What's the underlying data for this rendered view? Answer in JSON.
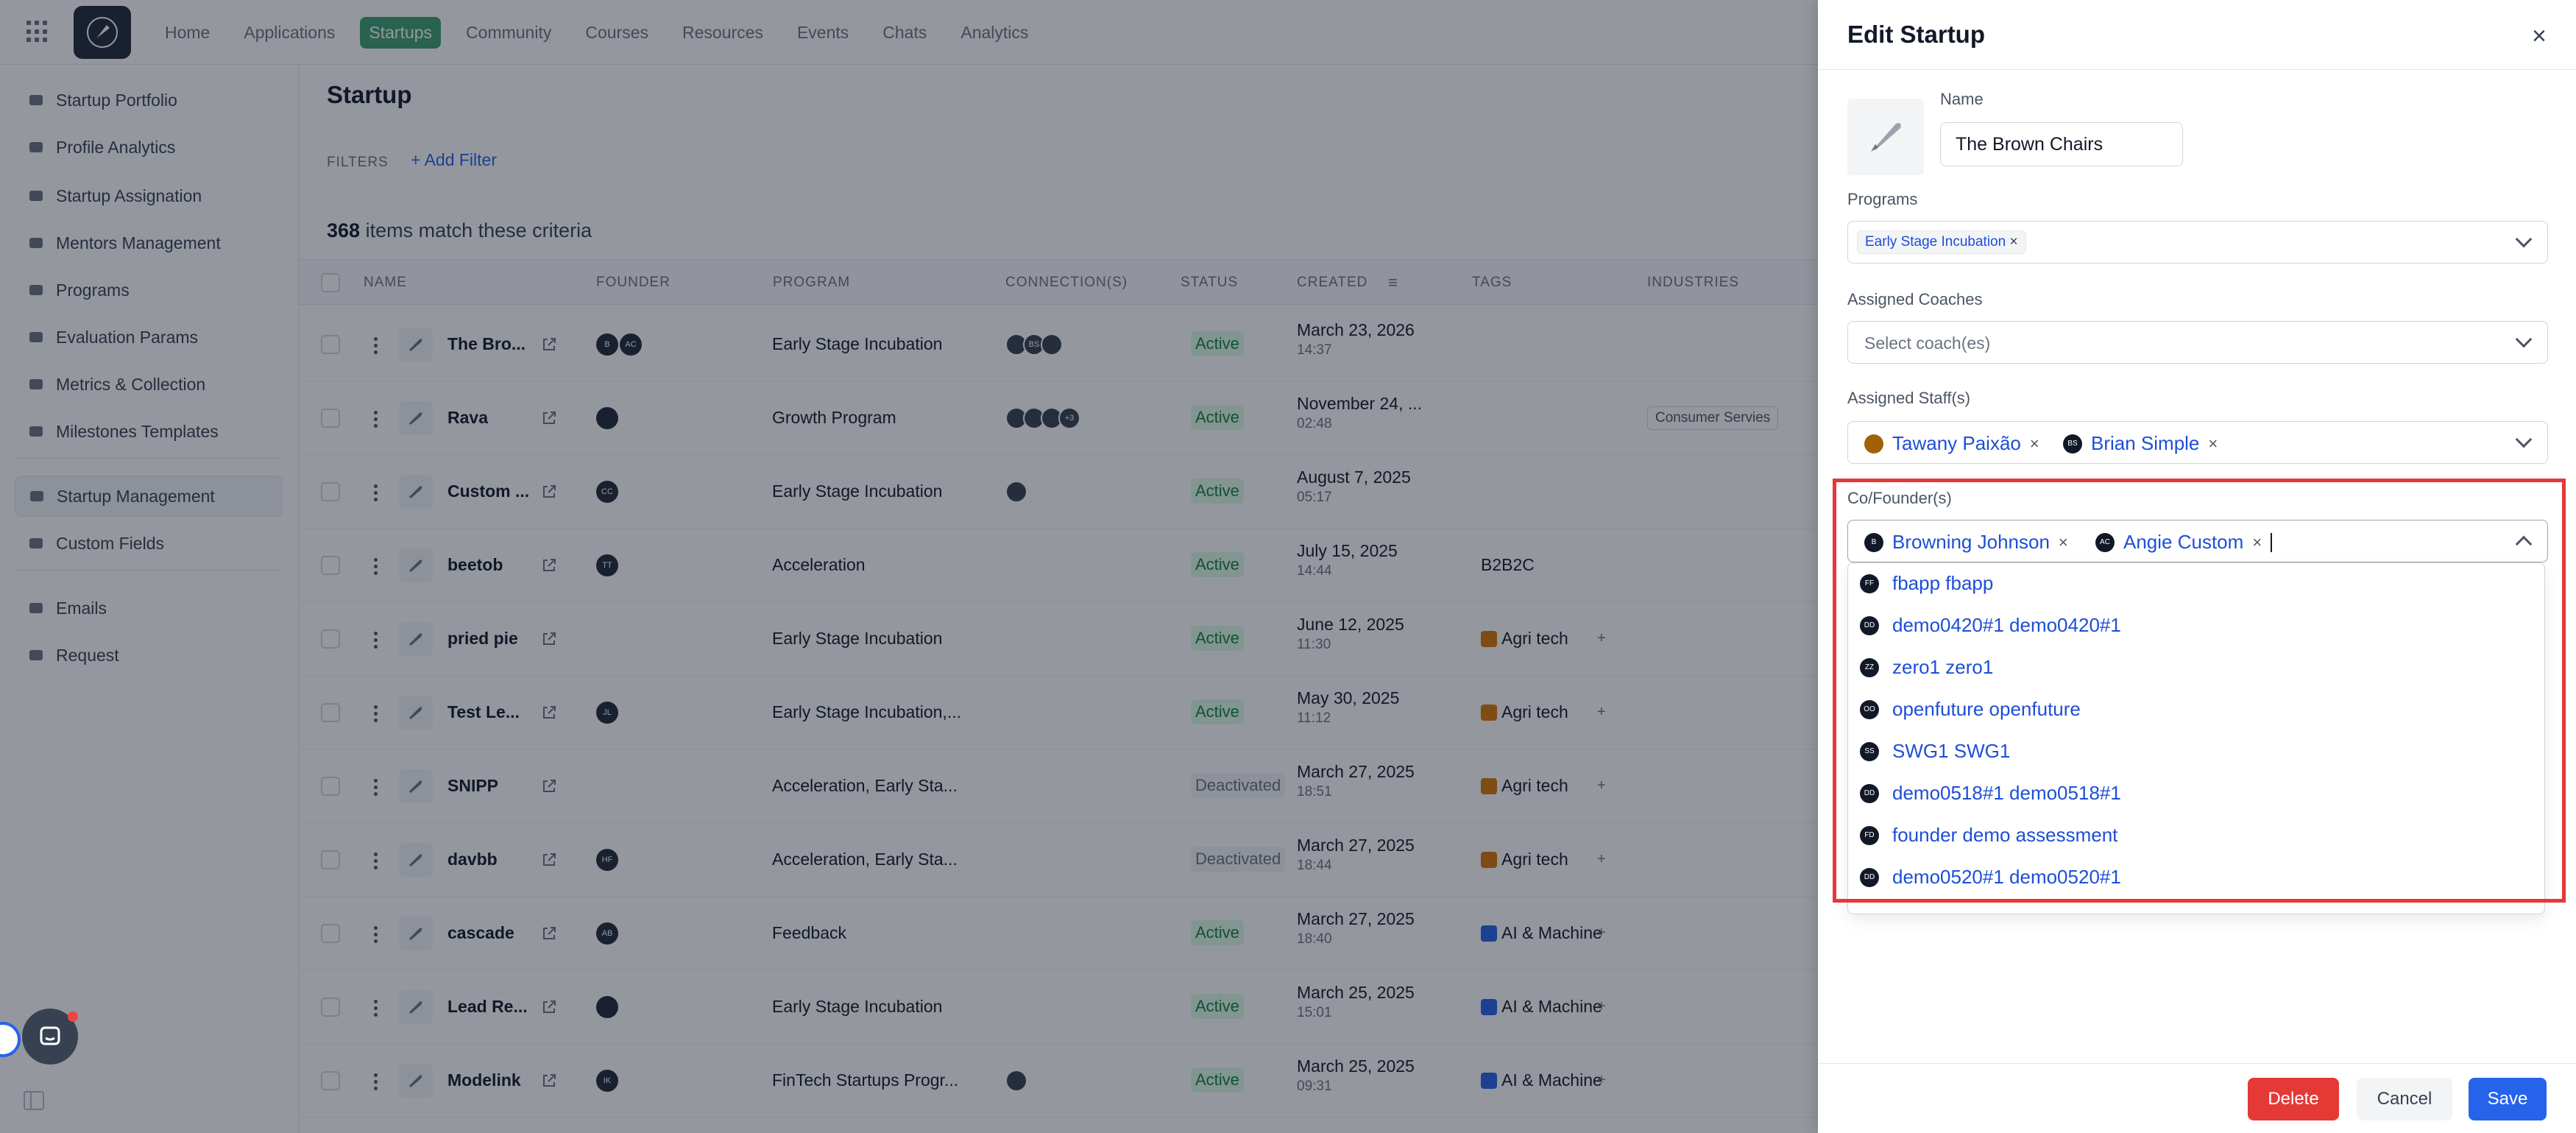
{
  "nav": {
    "items": [
      "Home",
      "Applications",
      "Startups",
      "Community",
      "Courses",
      "Resources",
      "Events",
      "Chats",
      "Analytics"
    ],
    "active": "Startups"
  },
  "sidebar": {
    "items": [
      {
        "label": "Startup Portfolio",
        "icon": "portfolio-icon"
      },
      {
        "label": "Profile Analytics",
        "icon": "bar-chart-icon"
      },
      {
        "label": "Startup Assignation",
        "icon": "assign-icon"
      },
      {
        "label": "Mentors Management",
        "icon": "users-icon"
      },
      {
        "label": "Programs",
        "icon": "rocket-icon"
      },
      {
        "label": "Evaluation Params",
        "icon": "scale-icon"
      },
      {
        "label": "Metrics & Collection",
        "icon": "pie-icon"
      },
      {
        "label": "Milestones Templates",
        "icon": "trophy-icon"
      },
      {
        "label": "Startup Management",
        "icon": "rocket-icon"
      },
      {
        "label": "Custom Fields",
        "icon": "fields-icon"
      },
      {
        "label": "Emails",
        "icon": "mail-icon"
      },
      {
        "label": "Request",
        "icon": "clipboard-icon"
      }
    ],
    "active": "Startup Management"
  },
  "main": {
    "title": "Startup",
    "filters_label": "FILTERS",
    "add_filter": "Add Filter",
    "count": "368",
    "count_suffix": "items match these criteria",
    "columns": [
      "NAME",
      "FOUNDER",
      "PROGRAM",
      "CONNECTION(S)",
      "STATUS",
      "CREATED",
      "TAGS",
      "INDUSTRIES"
    ],
    "rows": [
      {
        "name": "The Bro...",
        "founder": [
          "B",
          "AC"
        ],
        "program": "Early Stage Incubation",
        "connections": [
          "",
          "BS",
          ""
        ],
        "status": "Active",
        "date": "March 23, 2026",
        "time": "14:37",
        "tag": "",
        "tag_color": "",
        "industry": ""
      },
      {
        "name": "Rava",
        "founder": [
          ""
        ],
        "program": "Growth Program",
        "connections": [
          "",
          "",
          "",
          "+3"
        ],
        "status": "Active",
        "date": "November 24, ...",
        "time": "02:48",
        "tag": "",
        "tag_color": "",
        "industry": "Consumer Servies"
      },
      {
        "name": "Custom ...",
        "founder": [
          "CC"
        ],
        "program": "Early Stage Incubation",
        "connections": [
          ""
        ],
        "status": "Active",
        "date": "August 7, 2025",
        "time": "05:17",
        "tag": "",
        "tag_color": "",
        "industry": ""
      },
      {
        "name": "beetob",
        "founder": [
          "TT"
        ],
        "program": "Acceleration",
        "connections": [],
        "status": "Active",
        "date": "July 15, 2025",
        "time": "14:44",
        "tag": "B2B2C",
        "tag_color": "",
        "industry": ""
      },
      {
        "name": "pried pie",
        "founder": [],
        "program": "Early Stage Incubation",
        "connections": [],
        "status": "Active",
        "date": "June 12, 2025",
        "time": "11:30",
        "tag": "Agri tech",
        "tag_color": "#d97706",
        "industry": ""
      },
      {
        "name": "Test Le...",
        "founder": [
          "JL"
        ],
        "program": "Early Stage Incubation,...",
        "connections": [],
        "status": "Active",
        "date": "May 30, 2025",
        "time": "11:12",
        "tag": "Agri tech",
        "tag_color": "#d97706",
        "industry": ""
      },
      {
        "name": "SNIPP",
        "founder": [],
        "program": "Acceleration, Early Sta...",
        "connections": [],
        "status": "Deactivated",
        "date": "March 27, 2025",
        "time": "18:51",
        "tag": "Agri tech",
        "tag_color": "#d97706",
        "industry": ""
      },
      {
        "name": "davbb",
        "founder": [
          "HF"
        ],
        "program": "Acceleration, Early Sta...",
        "connections": [],
        "status": "Deactivated",
        "date": "March 27, 2025",
        "time": "18:44",
        "tag": "Agri tech",
        "tag_color": "#d97706",
        "industry": ""
      },
      {
        "name": "cascade",
        "founder": [
          "AB"
        ],
        "program": "Feedback",
        "connections": [],
        "status": "Active",
        "date": "March 27, 2025",
        "time": "18:40",
        "tag": "AI & Machine",
        "tag_color": "#2563eb",
        "industry": ""
      },
      {
        "name": "Lead Re...",
        "founder": [
          ""
        ],
        "program": "Early Stage Incubation",
        "connections": [],
        "status": "Active",
        "date": "March 25, 2025",
        "time": "15:01",
        "tag": "AI & Machine",
        "tag_color": "#2563eb",
        "industry": ""
      },
      {
        "name": "Modelink",
        "founder": [
          "IK"
        ],
        "program": "FinTech Startups Progr...",
        "connections": [
          ""
        ],
        "status": "Active",
        "date": "March 25, 2025",
        "time": "09:31",
        "tag": "AI & Machine",
        "tag_color": "#2563eb",
        "industry": ""
      }
    ]
  },
  "panel": {
    "title": "Edit Startup",
    "name_label": "Name",
    "name_value": "The Brown Chairs",
    "programs_label": "Programs",
    "programs": [
      "Early Stage Incubation"
    ],
    "coaches_label": "Assigned Coaches",
    "coaches_placeholder": "Select coach(es)",
    "staff_label": "Assigned Staff(s)",
    "staff": [
      {
        "name": "Tawany Paixão",
        "initials": ""
      },
      {
        "name": "Brian Simple",
        "initials": "BS"
      }
    ],
    "founders_label": "Co/Founder(s)",
    "founders": [
      {
        "name": "Browning Johnson",
        "initials": "B"
      },
      {
        "name": "Angie Custom",
        "initials": "AC"
      }
    ],
    "options": [
      {
        "name": "fbapp fbapp",
        "initials": "FF"
      },
      {
        "name": "demo0420#1 demo0420#1",
        "initials": "DD"
      },
      {
        "name": "zero1 zero1",
        "initials": "ZZ"
      },
      {
        "name": "openfuture openfuture",
        "initials": "OO"
      },
      {
        "name": "SWG1 SWG1",
        "initials": "SS"
      },
      {
        "name": "demo0518#1 demo0518#1",
        "initials": "DD"
      },
      {
        "name": "founder demo assessment",
        "initials": "FD"
      },
      {
        "name": "demo0520#1 demo0520#1",
        "initials": "DD"
      }
    ],
    "delete_label": "Delete",
    "cancel_label": "Cancel",
    "save_label": "Save"
  },
  "colors": {
    "accent": "#3f9f72",
    "primary": "#2563eb",
    "danger": "#e53935",
    "highlight": "#e53935"
  }
}
